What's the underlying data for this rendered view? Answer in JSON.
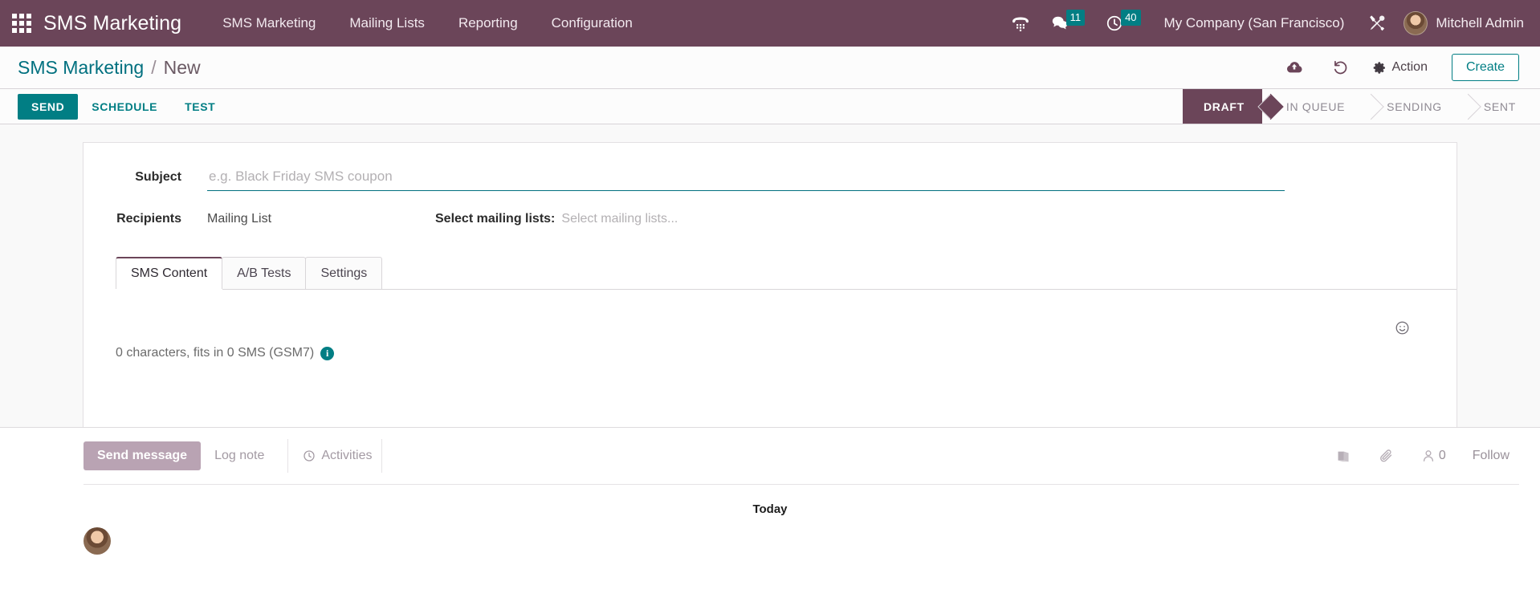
{
  "navbar": {
    "apps_icon": "apps-grid-icon",
    "brand": "SMS Marketing",
    "menu": [
      {
        "label": "SMS Marketing"
      },
      {
        "label": "Mailing Lists"
      },
      {
        "label": "Reporting"
      },
      {
        "label": "Configuration"
      }
    ],
    "phone_icon": "dialpad-phone-icon",
    "messages": {
      "icon": "chat-bubble-icon",
      "count": "11"
    },
    "activities": {
      "icon": "clock-icon",
      "count": "40"
    },
    "company": "My Company (San Francisco)",
    "tools_icon": "wrench-screwdriver-icon",
    "user": "Mitchell Admin",
    "accent_color": "#6b4559",
    "badge_color": "#017e84"
  },
  "control_panel": {
    "breadcrumb_root": "SMS Marketing",
    "breadcrumb_separator": "/",
    "breadcrumb_current": "New",
    "save_icon": "cloud-upload-icon",
    "discard_icon": "undo-arrow-icon",
    "action_gear_icon": "gear-icon",
    "action_label": "Action",
    "create_label": "Create"
  },
  "statusbar": {
    "buttons": [
      {
        "label": "SEND",
        "primary": true
      },
      {
        "label": "SCHEDULE",
        "primary": false
      },
      {
        "label": "TEST",
        "primary": false
      }
    ],
    "stages": [
      {
        "label": "DRAFT",
        "active": true
      },
      {
        "label": "IN QUEUE",
        "active": false
      },
      {
        "label": "SENDING",
        "active": false
      },
      {
        "label": "SENT",
        "active": false
      }
    ]
  },
  "form": {
    "subject_label": "Subject",
    "subject_value": "",
    "subject_placeholder": "e.g. Black Friday SMS coupon",
    "recipients_label": "Recipients",
    "recipients_value": "Mailing List",
    "mailing_lists_label": "Select mailing lists:",
    "mailing_lists_value": "",
    "mailing_lists_placeholder": "Select mailing lists..."
  },
  "tabs": [
    {
      "label": "SMS Content",
      "active": true
    },
    {
      "label": "A/B Tests",
      "active": false
    },
    {
      "label": "Settings",
      "active": false
    }
  ],
  "sms_content": {
    "body_value": "",
    "emoji_icon": "smiley-face-icon",
    "char_counter": "0 characters, fits in 0 SMS (GSM7)",
    "info_icon": "info-circle-icon",
    "info_glyph": "i"
  },
  "chatter": {
    "send_message_label": "Send message",
    "log_note_label": "Log note",
    "activities_icon": "clock-icon",
    "activities_label": "Activities",
    "log_icon": "book-icon",
    "attachment_icon": "paperclip-icon",
    "followers_icon": "person-icon",
    "followers_count": "0",
    "follow_label": "Follow",
    "date_divider": "Today"
  }
}
